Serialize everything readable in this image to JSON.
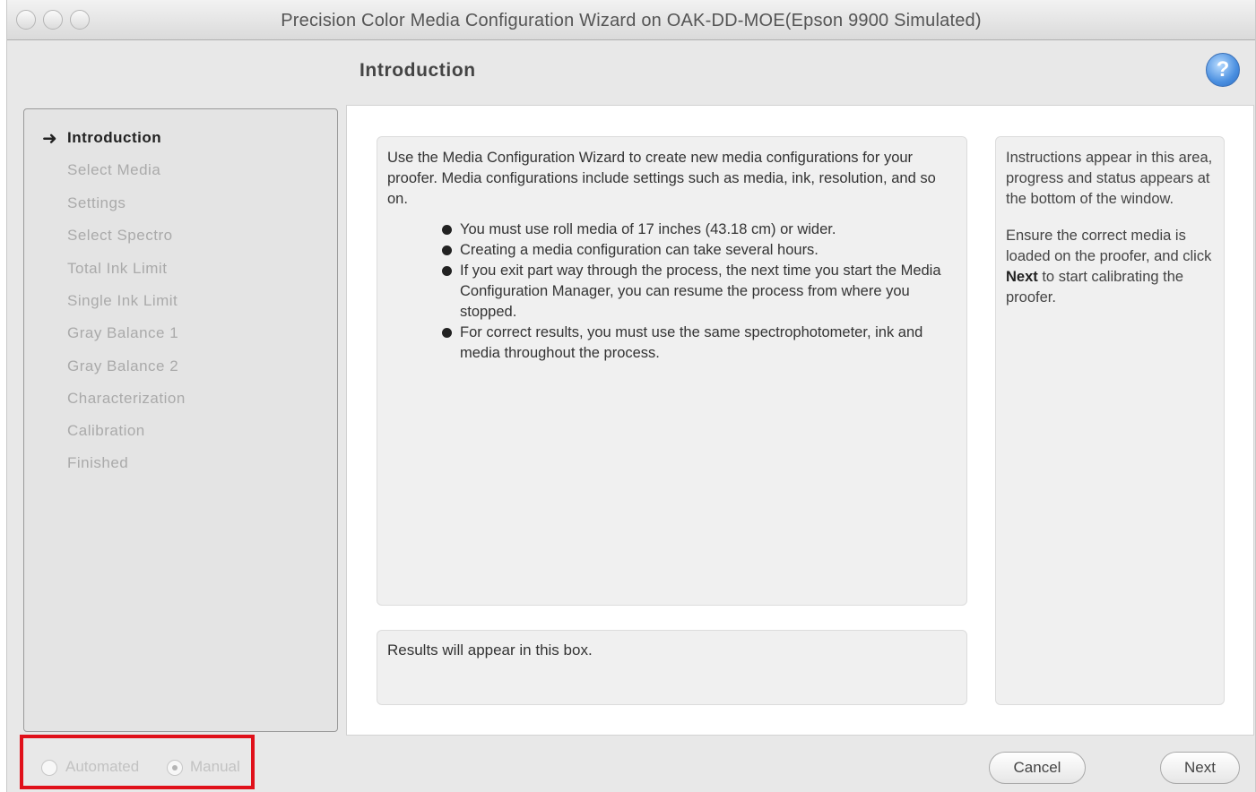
{
  "window": {
    "title": "Precision Color Media Configuration Wizard on OAK-DD-MOE(Epson 9900 Simulated)"
  },
  "header": {
    "heading": "Introduction",
    "help_label": "?"
  },
  "steps": [
    {
      "label": "Introduction",
      "current": true
    },
    {
      "label": "Select Media",
      "current": false
    },
    {
      "label": "Settings",
      "current": false
    },
    {
      "label": "Select Spectro",
      "current": false
    },
    {
      "label": "Total Ink Limit",
      "current": false
    },
    {
      "label": "Single Ink Limit",
      "current": false
    },
    {
      "label": "Gray Balance 1",
      "current": false
    },
    {
      "label": "Gray Balance 2",
      "current": false
    },
    {
      "label": "Characterization",
      "current": false
    },
    {
      "label": "Calibration",
      "current": false
    },
    {
      "label": "Finished",
      "current": false
    }
  ],
  "main": {
    "intro": "Use the Media Configuration Wizard to create new media configurations for your proofer. Media configurations include settings such as media, ink, resolution, and so on.",
    "bullets": [
      "You must use roll media of 17 inches (43.18 cm) or wider.",
      "Creating a media configuration can take several hours.",
      "If you exit part way through the process, the next time you start the Media Configuration Manager, you can resume the process from where you stopped.",
      "For correct results, you must use the same spectrophotometer, ink and media throughout the process."
    ],
    "results": "Results will appear in this box."
  },
  "instructions": {
    "para1": "Instructions appear in this area, progress and status appears at the bottom of the window.",
    "para2_before": "Ensure the correct media is loaded on the proofer, and click ",
    "para2_bold": "Next",
    "para2_after": " to start calibrating the proofer."
  },
  "mode": {
    "automated_label": "Automated",
    "manual_label": "Manual",
    "selected": "Manual"
  },
  "footer": {
    "cancel_label": "Cancel",
    "next_label": "Next"
  },
  "colors": {
    "highlight_outline": "#e0101a",
    "help_icon": "#4a8fe0"
  }
}
